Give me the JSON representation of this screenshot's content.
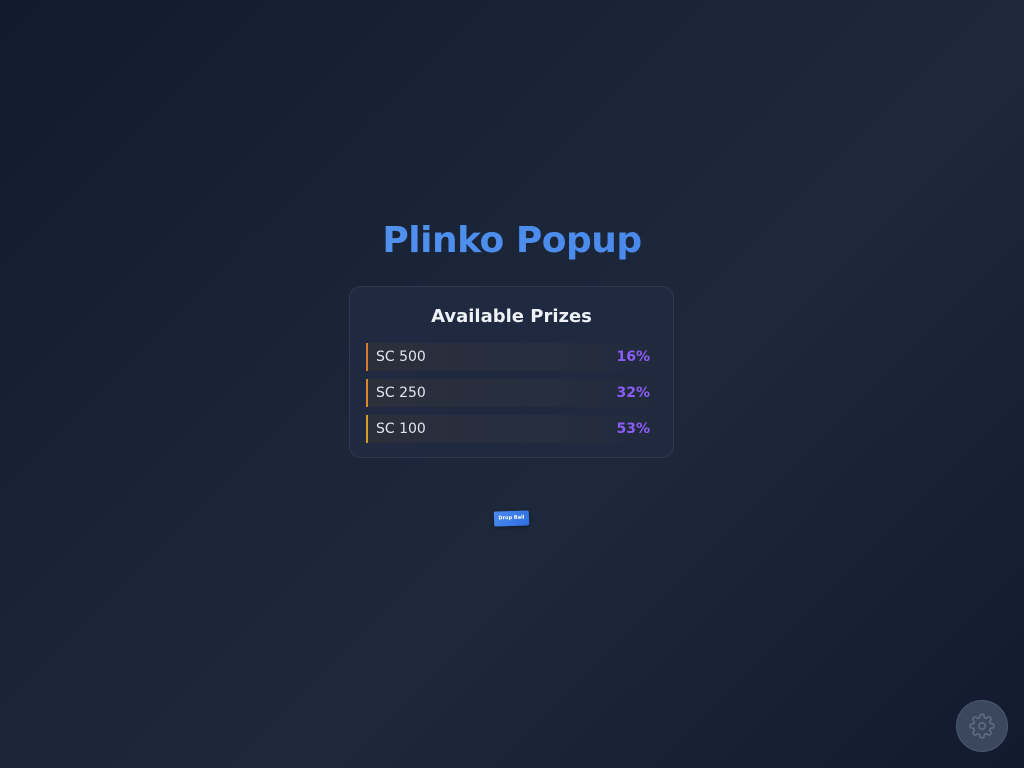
{
  "header": {
    "title": "Plinko Popup"
  },
  "prizes": {
    "title": "Available Prizes",
    "items": [
      {
        "name": "SC 500",
        "percent": "16%",
        "accent": "#d9792b"
      },
      {
        "name": "SC 250",
        "percent": "32%",
        "accent": "#e0872e"
      },
      {
        "name": "SC 100",
        "percent": "53%",
        "accent": "#d99b2a"
      }
    ],
    "percent_color": "#8b5cf6"
  },
  "actions": {
    "drop_label": "Drop Ball"
  },
  "settings": {
    "icon": "gear-icon"
  },
  "colors": {
    "title_gradient_start": "#5a9cf2",
    "title_gradient_end": "#3f7fe8",
    "button_blue": "#3b7de8"
  }
}
